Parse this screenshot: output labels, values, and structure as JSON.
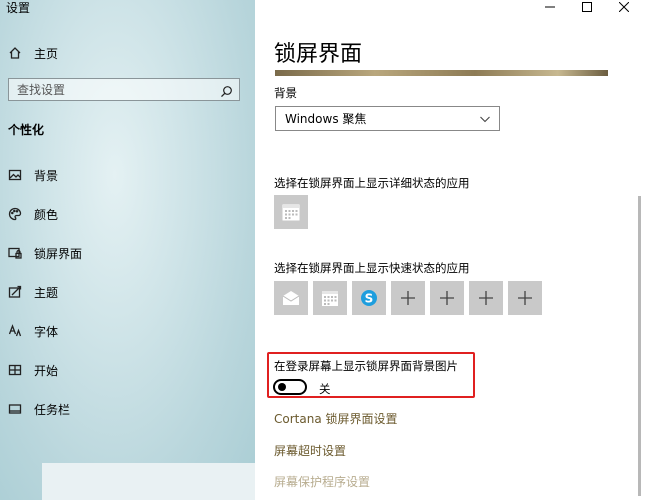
{
  "window": {
    "title": "设置"
  },
  "sidebar": {
    "home": "主页",
    "search_placeholder": "查找设置",
    "section": "个性化",
    "items": [
      {
        "label": "背景",
        "icon": "image-icon"
      },
      {
        "label": "颜色",
        "icon": "palette-icon"
      },
      {
        "label": "锁屏界面",
        "icon": "lock-screen-icon"
      },
      {
        "label": "主题",
        "icon": "theme-icon"
      },
      {
        "label": "字体",
        "icon": "font-icon"
      },
      {
        "label": "开始",
        "icon": "start-icon"
      },
      {
        "label": "任务栏",
        "icon": "taskbar-icon"
      }
    ]
  },
  "main": {
    "title": "锁屏界面",
    "background_label": "背景",
    "background_value": "Windows 聚焦",
    "detailed_status_label": "选择在锁屏界面上显示详细状态的应用",
    "quick_status_label": "选择在锁屏界面上显示快速状态的应用",
    "quick_tiles": [
      {
        "icon": "mail-icon"
      },
      {
        "icon": "calendar-icon"
      },
      {
        "icon": "skype-icon"
      },
      {
        "icon": "plus-icon"
      },
      {
        "icon": "plus-icon"
      },
      {
        "icon": "plus-icon"
      },
      {
        "icon": "plus-icon"
      }
    ],
    "signin_bg_label": "在登录屏幕上显示锁屏界面背景图片",
    "toggle_state": "关",
    "cortana_link": "Cortana 锁屏界面设置",
    "timeout_link": "屏幕超时设置",
    "screensaver_link": "屏幕保护程序设置"
  },
  "colors": {
    "highlight": "#e02020",
    "link": "#6b5a2e",
    "tile": "#c9c9c9",
    "skype": "#1e9ede"
  }
}
